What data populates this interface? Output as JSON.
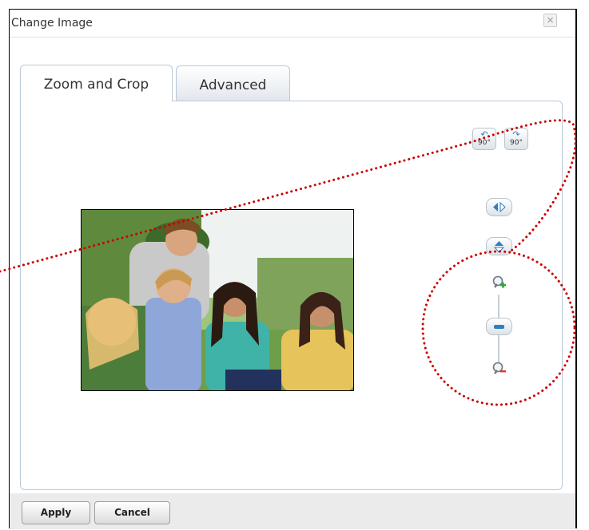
{
  "dialog": {
    "title": "Change Image",
    "close_label": "×"
  },
  "tabs": [
    {
      "label": "Zoom and Crop",
      "active": true
    },
    {
      "label": "Advanced",
      "active": false
    }
  ],
  "toolbar": {
    "rotate_left": "90°",
    "rotate_right": "90°",
    "flip_horizontal": "flip-horizontal-icon",
    "flip_vertical": "flip-vertical-icon",
    "zoom_in": "zoom-in-icon",
    "zoom_out": "zoom-out-icon",
    "zoom_level": 0.5
  },
  "footer": {
    "apply": "Apply",
    "cancel": "Cancel"
  },
  "colors": {
    "accent": "#2f7fc1",
    "annotation": "#cc0000",
    "footer_bg": "#ebebeb"
  }
}
